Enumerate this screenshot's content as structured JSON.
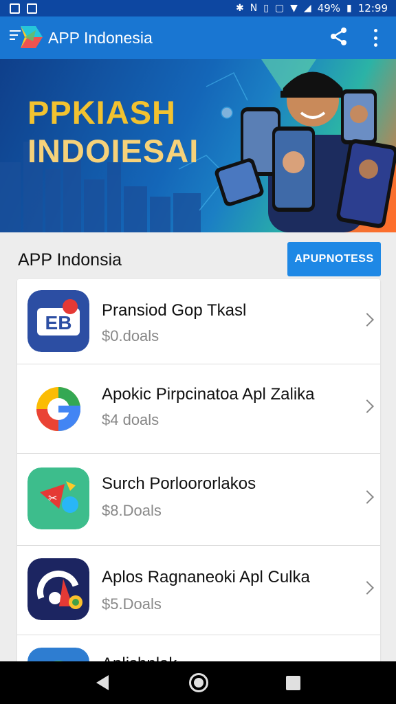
{
  "status_bar": {
    "battery": "49%",
    "time": "12:99"
  },
  "appbar": {
    "title": "APP Indonesia"
  },
  "banner": {
    "line1": "PPKIASH",
    "line2": "INDOIESAI"
  },
  "section": {
    "title": "APP Indonsia",
    "button_label": "APUPNOTESS"
  },
  "apps": [
    {
      "title": "Pransiod Gop Tkasl",
      "price": "$0.doals"
    },
    {
      "title": "Apokic Pirpcinatoa Apl Zalika",
      "price": "$4 doals"
    },
    {
      "title": "Surch Porloororlakos",
      "price": "$8.Doals"
    },
    {
      "title": "Aplos Ragnaneoki Apl Culka",
      "price": "$5.Doals"
    },
    {
      "title": "Aplishnlak",
      "price": ""
    }
  ],
  "colors": {
    "status_bar": "#0d47a1",
    "appbar": "#1976d2",
    "accent_button": "#1e88e5",
    "banner_text": "#f2c230"
  }
}
